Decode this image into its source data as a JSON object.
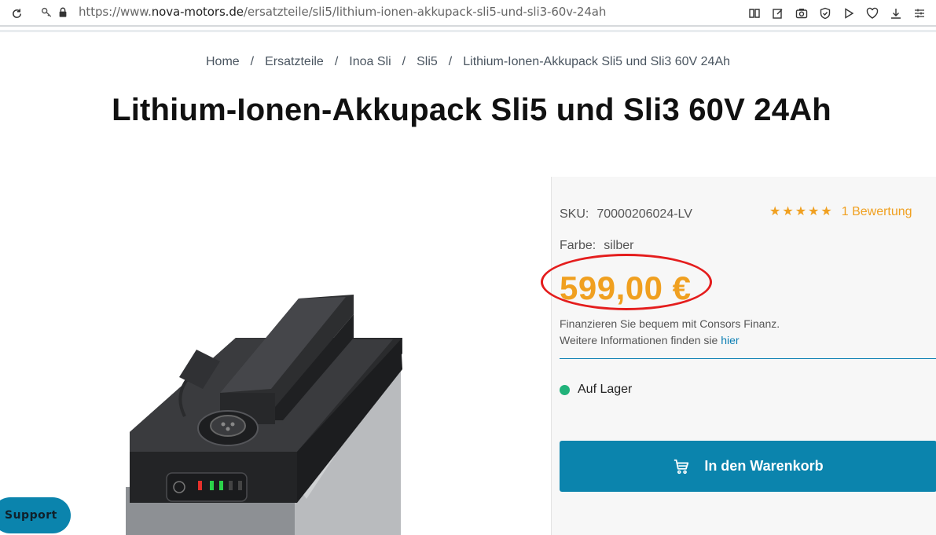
{
  "browser": {
    "url_prefix": "https://www.",
    "url_host": "nova-motors.de",
    "url_path": "/ersatzteile/sli5/lithium-ionen-akkupack-sli5-und-sli3-60v-24ah"
  },
  "breadcrumb": [
    "Home",
    "Ersatzteile",
    "Inoa Sli",
    "Sli5",
    "Lithium-Ionen-Akkupack Sli5 und Sli3 60V 24Ah"
  ],
  "breadcrumb_separator": "/",
  "page_title": "Lithium-Ionen-Akkupack Sli5 und Sli3 60V 24Ah",
  "product": {
    "sku_label": "SKU:",
    "sku_value": "70000206024-LV",
    "rating_stars": 5,
    "rating_link": "1 Bewertung",
    "color_label": "Farbe:",
    "color_value": "silber",
    "price": "599,00 €",
    "finance_line1": "Finanzieren Sie bequem mit Consors Finanz.",
    "finance_line2": "Weitere Informationen finden sie",
    "finance_link": "hier",
    "stock_label": "Auf Lager",
    "cart_button": "In den Warenkorb"
  },
  "support_label": "Support",
  "colors": {
    "accent": "#f0a020",
    "button": "#0b84ad",
    "stock": "#21b27a",
    "highlight_ring": "#e41d1d"
  }
}
